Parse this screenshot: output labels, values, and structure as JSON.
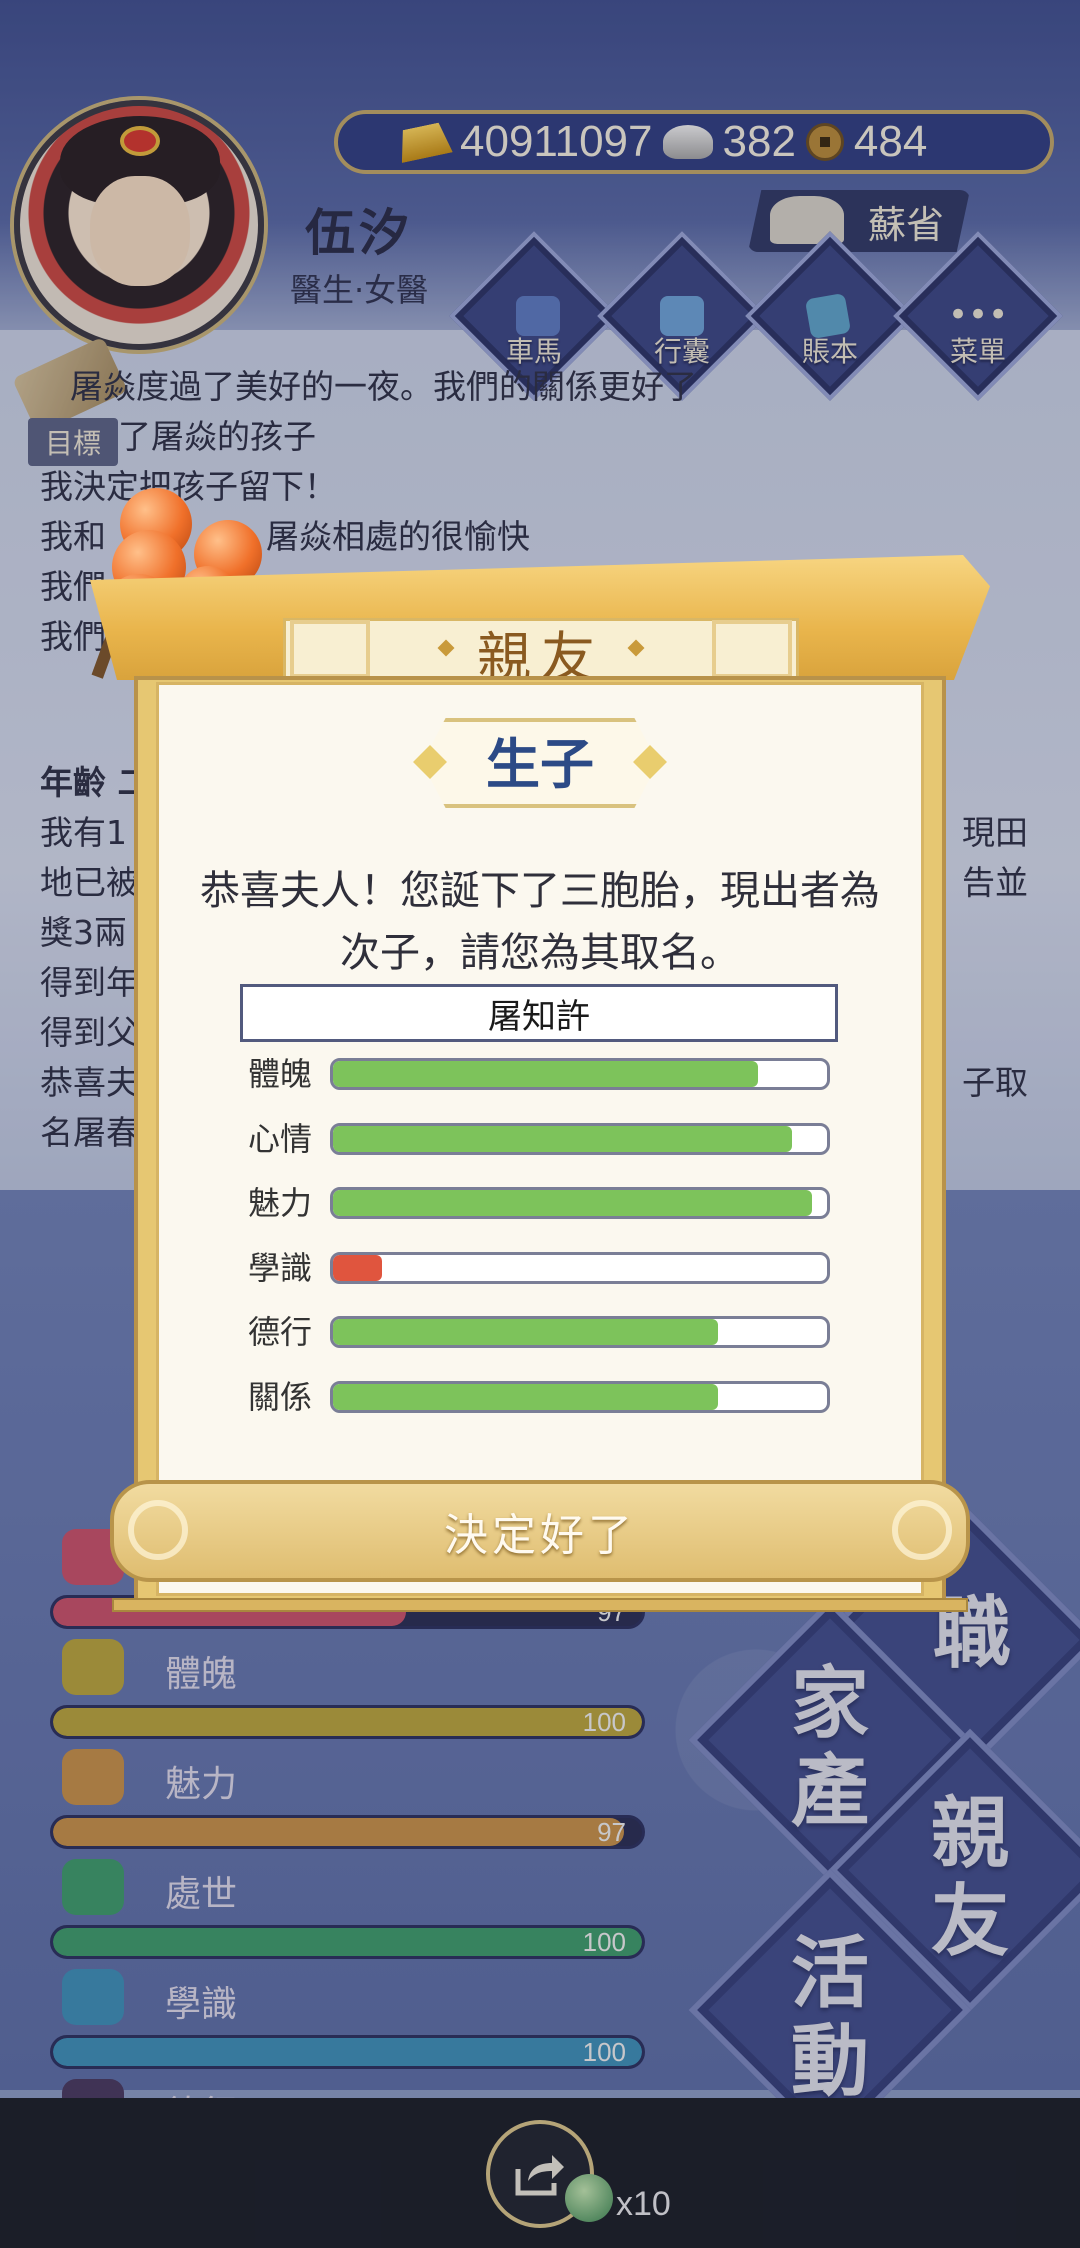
{
  "header": {
    "currency": {
      "gold": "40911097",
      "silver": "382",
      "coin": "484"
    },
    "player_name": "伍汐",
    "player_title": "醫生·女醫",
    "location": "蘇省",
    "nav": [
      {
        "label": "車馬",
        "icon": "carriage-icon"
      },
      {
        "label": "行囊",
        "icon": "bag-icon"
      },
      {
        "label": "賬本",
        "icon": "ledger-icon"
      },
      {
        "label": "菜單",
        "icon": "menu-icon"
      }
    ]
  },
  "story": {
    "goal_label": "目標",
    "lines": [
      "屠焱度過了美好的一夜。我們的關係更好了",
      "了屠焱的孩子",
      "我決定把孩子留下！",
      "我和",
      "我們",
      "我們"
    ],
    "line_fragments": {
      "line4_tail": "屠焱相處的很愉快"
    },
    "age_heading": "年齡 二",
    "para": [
      {
        "left": "我有1",
        "right": "現田"
      },
      {
        "left": "地已被",
        "right": "告並"
      },
      {
        "left": "獎3兩",
        "right": ""
      },
      {
        "left": "得到年",
        "right": ""
      },
      {
        "left": "得到父",
        "right": ""
      },
      {
        "left": "恭喜夫",
        "right": "子取"
      },
      {
        "left": "名屠春",
        "right": ""
      }
    ]
  },
  "stats_bg": [
    {
      "name": "",
      "value": "97",
      "fraction": 0.6,
      "color": "#c8526b",
      "icon": "flower-icon"
    },
    {
      "name": "體魄",
      "value": "100",
      "fraction": 1.0,
      "color": "#b9a43e",
      "icon": "vase-icon"
    },
    {
      "name": "魅力",
      "value": "97",
      "fraction": 0.97,
      "color": "#c6904a",
      "icon": "mirror-icon"
    },
    {
      "name": "處世",
      "value": "100",
      "fraction": 1.0,
      "color": "#3f9b6c",
      "icon": "fan-icon"
    },
    {
      "name": "學識",
      "value": "100",
      "fraction": 1.0,
      "color": "#3f8fb8",
      "icon": "books-icon"
    },
    {
      "name": "德行",
      "value": "",
      "fraction": 0.3,
      "color": "#4a3a60",
      "icon": "coin-icon"
    }
  ],
  "big_menu": {
    "job": "職",
    "property": "家產",
    "friends": "親友",
    "activity": "活動"
  },
  "modal": {
    "title": "親友",
    "subtitle": "生子",
    "message": "恭喜夫人！您誕下了三胞胎，現出者為次子，請您為其取名。",
    "name_value": "屠知許",
    "stats": [
      {
        "label": "體魄",
        "fraction": 0.86,
        "color": "#7dc35b"
      },
      {
        "label": "心情",
        "fraction": 0.93,
        "color": "#7dc35b"
      },
      {
        "label": "魅力",
        "fraction": 0.97,
        "color": "#7dc35b"
      },
      {
        "label": "學識",
        "fraction": 0.1,
        "color": "#e0553e"
      },
      {
        "label": "德行",
        "fraction": 0.78,
        "color": "#7dc35b"
      },
      {
        "label": "關係",
        "fraction": 0.78,
        "color": "#7dc35b"
      }
    ],
    "confirm_label": "決定好了"
  },
  "share": {
    "reward_count": "x10"
  }
}
